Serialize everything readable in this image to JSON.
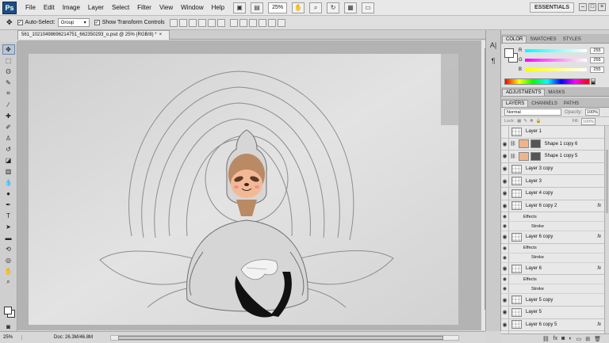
{
  "app": {
    "logo": "Ps"
  },
  "menu": [
    "File",
    "Edit",
    "Image",
    "Layer",
    "Select",
    "Filter",
    "View",
    "Window",
    "Help"
  ],
  "menubar_tools": {
    "zoom": "25%",
    "essentials": "ESSENTIALS"
  },
  "options": {
    "auto_select_label": "Auto-Select:",
    "auto_select_value": "Group",
    "transform_label": "Show Transform Controls"
  },
  "document": {
    "tab_title": "561_1021049869621475​1_662350293_o.psd @ 25% (RGB/8) *",
    "close": "×"
  },
  "status": {
    "zoom": "25%",
    "doc_size": "Doc: 26.3M/46.8M"
  },
  "color_panel": {
    "tabs": [
      "COLOR",
      "SWATCHES",
      "STYLES"
    ],
    "channels": [
      {
        "label": "R",
        "value": "255"
      },
      {
        "label": "G",
        "value": "255"
      },
      {
        "label": "B",
        "value": "255"
      }
    ]
  },
  "adjust_panel": {
    "tabs": [
      "ADJUSTMENTS",
      "MASKS"
    ]
  },
  "layers_panel": {
    "tabs": [
      "LAYERS",
      "CHANNELS",
      "PATHS"
    ],
    "blend_mode": "Normal",
    "opacity_label": "Opacity:",
    "opacity": "100%",
    "lock_label": "Lock:",
    "fill_label": "Fill:",
    "fill": "100%",
    "effects_label": "Effects",
    "stroke_label": "Stroke",
    "layers": [
      {
        "name": "Layer 1",
        "visible": false,
        "kind": "pixel"
      },
      {
        "name": "Shape 1 copy 6",
        "visible": true,
        "kind": "shape"
      },
      {
        "name": "Shape 1 copy 5",
        "visible": true,
        "kind": "shape"
      },
      {
        "name": "Layer 3 copy",
        "visible": true,
        "kind": "pixel"
      },
      {
        "name": "Layer 3",
        "visible": true,
        "kind": "pixel"
      },
      {
        "name": "Layer 4 copy",
        "visible": true,
        "kind": "pixel"
      },
      {
        "name": "Layer 6 copy 2",
        "visible": true,
        "kind": "pixel",
        "fx": "fx"
      },
      {
        "name": "Layer 6 copy",
        "visible": true,
        "kind": "pixel",
        "fx": "fx"
      },
      {
        "name": "Layer 6",
        "visible": true,
        "kind": "pixel",
        "fx": "fx"
      },
      {
        "name": "Layer 5 copy",
        "visible": true,
        "kind": "pixel"
      },
      {
        "name": "Layer 5",
        "visible": true,
        "kind": "pixel"
      },
      {
        "name": "Layer 6 copy 5",
        "visible": true,
        "kind": "pixel",
        "fx": "fx"
      }
    ]
  },
  "colors": {
    "accent": "#1b4f84",
    "sloth_face": "#f3b997",
    "sloth_fur": "#b98a63"
  }
}
